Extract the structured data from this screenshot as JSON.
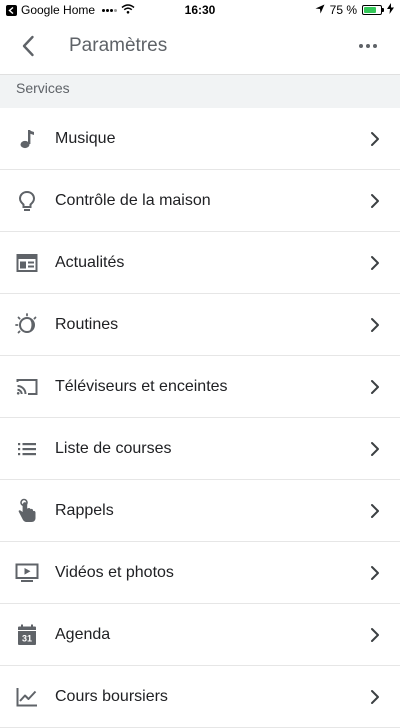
{
  "status_bar": {
    "app": "Google Home",
    "time": "16:30",
    "battery": "75 %",
    "battery_level": 0.75
  },
  "header": {
    "title": "Paramètres"
  },
  "section": {
    "title": "Services"
  },
  "items": [
    {
      "label": "Musique",
      "icon": "music-note-icon"
    },
    {
      "label": "Contrôle de la maison",
      "icon": "lightbulb-icon"
    },
    {
      "label": "Actualités",
      "icon": "news-icon"
    },
    {
      "label": "Routines",
      "icon": "routines-icon",
      "highlighted": true,
      "highlight_color": "#f5a11a"
    },
    {
      "label": "Téléviseurs et enceintes",
      "icon": "cast-icon"
    },
    {
      "label": "Liste de courses",
      "icon": "list-icon"
    },
    {
      "label": "Rappels",
      "icon": "reminder-hand-icon"
    },
    {
      "label": "Vidéos et photos",
      "icon": "video-icon"
    },
    {
      "label": "Agenda",
      "icon": "calendar-icon",
      "icon_text": "31"
    },
    {
      "label": "Cours boursiers",
      "icon": "stocks-icon"
    }
  ]
}
